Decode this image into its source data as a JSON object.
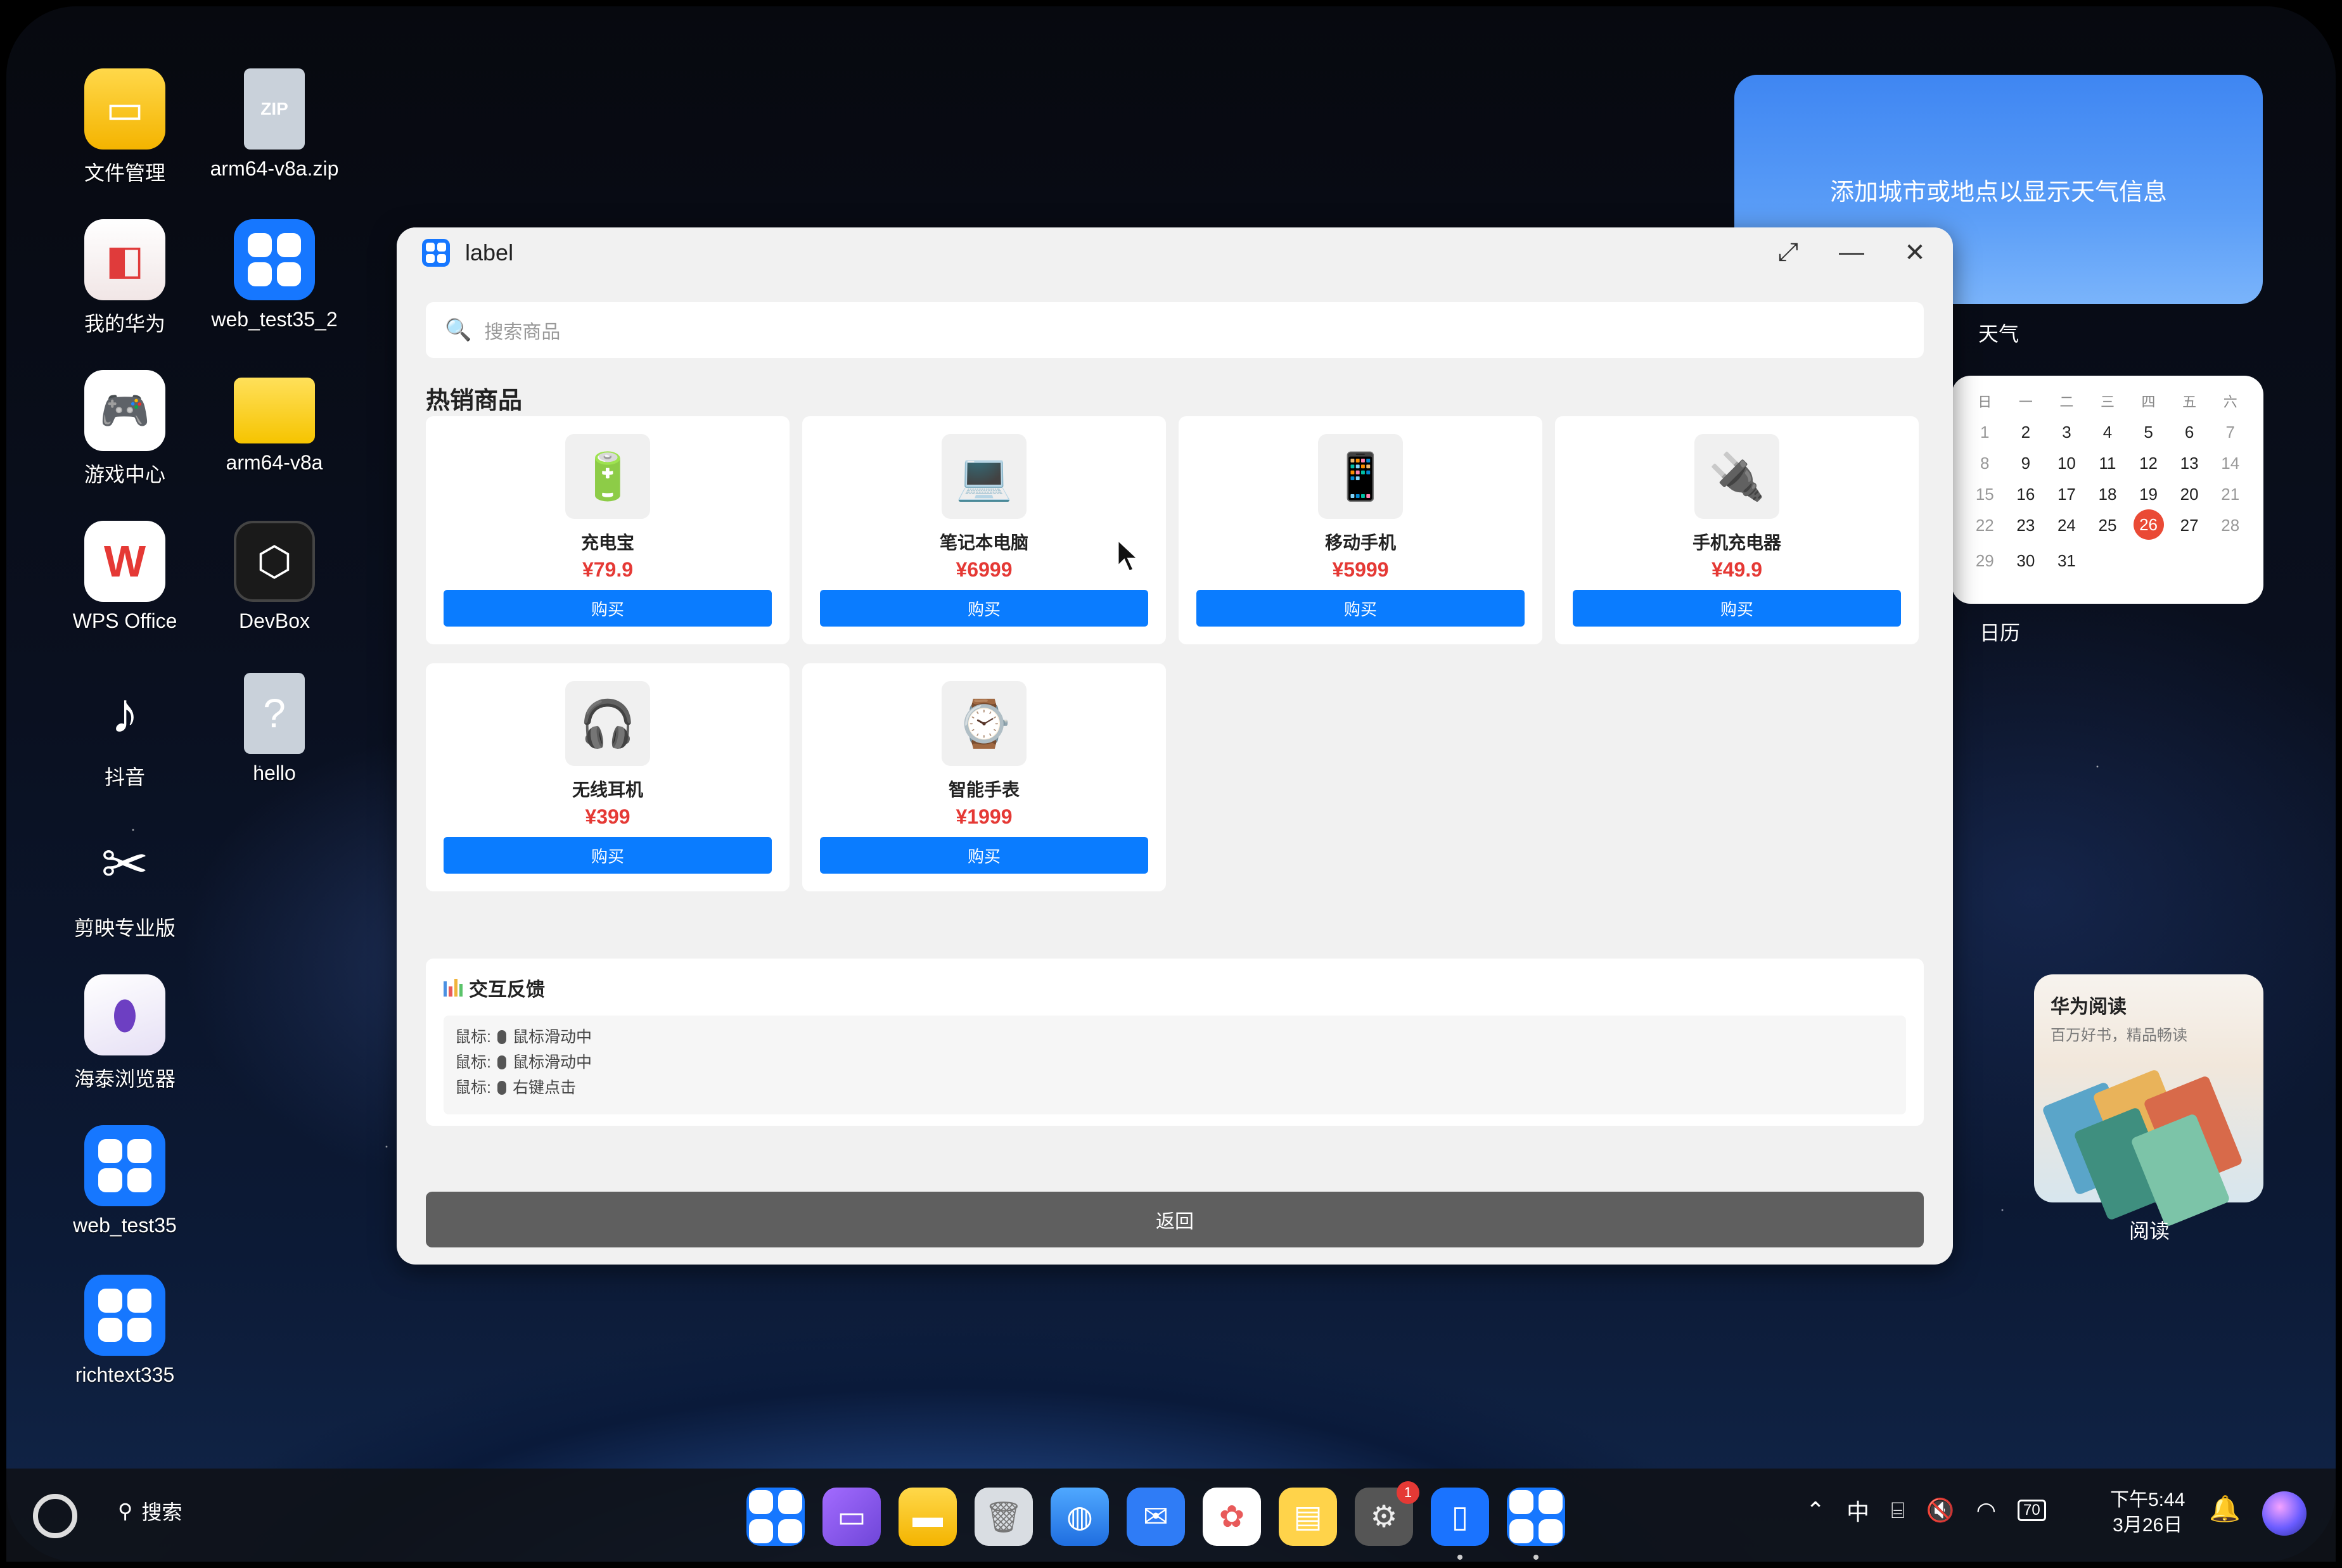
{
  "desktop": {
    "icons": [
      {
        "label": "文件管理"
      },
      {
        "label": "arm64-v8a.zip"
      },
      {
        "label": "我的华为"
      },
      {
        "label": "web_test35_2"
      },
      {
        "label": "游戏中心"
      },
      {
        "label": "arm64-v8a"
      },
      {
        "label": "WPS Office"
      },
      {
        "label": "DevBox"
      },
      {
        "label": "抖音"
      },
      {
        "label": "hello"
      },
      {
        "label": "剪映专业版"
      },
      {
        "label": "海泰浏览器"
      },
      {
        "label": "web_test35"
      },
      {
        "label": "richtext335"
      }
    ],
    "zip_badge": "ZIP"
  },
  "widgets": {
    "weather": {
      "message": "添加城市或地点以显示天气信息",
      "label": "天气"
    },
    "calendar": {
      "label": "日历",
      "weekdays": [
        "日",
        "一",
        "二",
        "三",
        "四",
        "五",
        "六"
      ],
      "days": [
        "",
        "1",
        "2",
        "3",
        "4",
        "5",
        "6",
        "7",
        "8",
        "9",
        "10",
        "11",
        "12",
        "13",
        "14",
        "15",
        "16",
        "17",
        "18",
        "19",
        "20",
        "21",
        "22",
        "23",
        "24",
        "25",
        "26",
        "27",
        "28",
        "29",
        "30",
        "31"
      ],
      "today": "26"
    },
    "reading": {
      "title": "华为阅读",
      "subtitle": "百万好书，精品畅读",
      "label": "阅读"
    }
  },
  "window": {
    "title": "label",
    "search_placeholder": "搜索商品",
    "section_title": "热销商品",
    "buy_label": "购买",
    "products": [
      {
        "name": "充电宝",
        "price": "¥79.9",
        "icon": "battery-icon"
      },
      {
        "name": "笔记本电脑",
        "price": "¥6999",
        "icon": "laptop-icon"
      },
      {
        "name": "移动手机",
        "price": "¥5999",
        "icon": "phone-icon"
      },
      {
        "name": "手机充电器",
        "price": "¥49.9",
        "icon": "charger-icon"
      },
      {
        "name": "无线耳机",
        "price": "¥399",
        "icon": "headphones-icon"
      },
      {
        "name": "智能手表",
        "price": "¥1999",
        "icon": "watch-icon"
      }
    ],
    "feedback": {
      "title": "交互反馈",
      "logs": [
        {
          "prefix": "鼠标:",
          "text": "鼠标滑动中"
        },
        {
          "prefix": "鼠标:",
          "text": "鼠标滑动中"
        },
        {
          "prefix": "鼠标:",
          "text": "右键点击"
        }
      ]
    },
    "back_label": "返回"
  },
  "taskbar": {
    "search_label": "搜索",
    "settings_badge": "1",
    "ime": "中",
    "battery": "70",
    "time": "下午5:44",
    "date": "3月26日"
  },
  "colors": {
    "accent": "#0a7cff",
    "price": "#e53935",
    "back_button": "#5f5f5f",
    "today": "#ea4a35"
  }
}
